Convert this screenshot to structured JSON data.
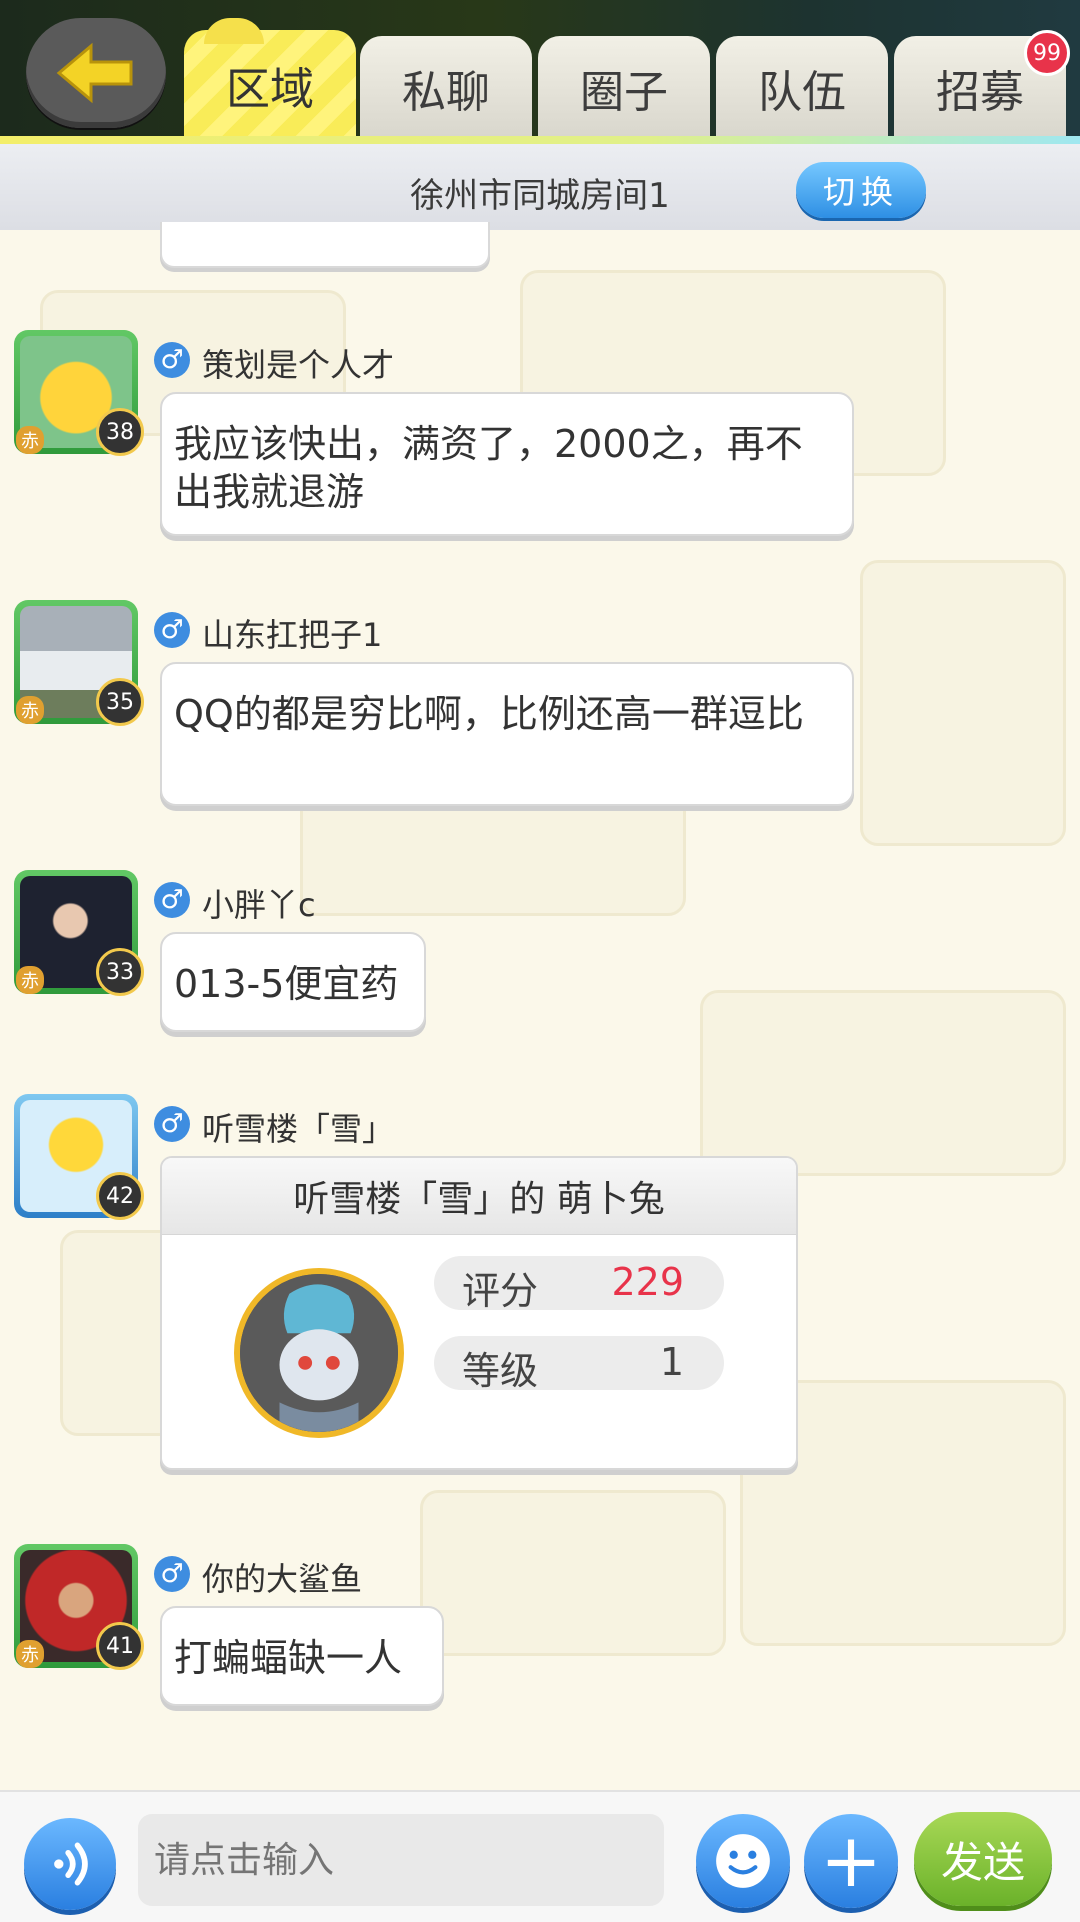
{
  "tabs": [
    {
      "label": "区域",
      "active": true
    },
    {
      "label": "私聊",
      "active": false
    },
    {
      "label": "圈子",
      "active": false
    },
    {
      "label": "队伍",
      "active": false
    },
    {
      "label": "招募",
      "active": false
    }
  ],
  "badge": "99",
  "room": {
    "title": "徐州市同城房间1",
    "switch_label": "切换"
  },
  "messages": [
    {
      "nick": "策划是个人才",
      "level": "38",
      "text": "我应该快出，满资了，2000之，再不出我就退游"
    },
    {
      "nick": "山东扛把子1",
      "level": "35",
      "text": "QQ的都是穷比啊，比例还高一群逗比"
    },
    {
      "nick": "小胖丫c",
      "level": "33",
      "text": "013-5便宜药"
    },
    {
      "nick": "听雪楼「雪」",
      "level": "42",
      "card": {
        "title": "听雪楼「雪」的 萌卜兔",
        "score_label": "评分",
        "score": "229",
        "grade_label": "等级",
        "grade": "1"
      }
    },
    {
      "nick": "你的大鲨鱼",
      "level": "41",
      "text": "打蝙蝠缺一人"
    }
  ],
  "input": {
    "placeholder": "请点击输入"
  },
  "send_label": "发送",
  "colors": {
    "accent_blue": "#2a7fe0",
    "send_green": "#6bb22a",
    "badge_red": "#e8334a"
  }
}
